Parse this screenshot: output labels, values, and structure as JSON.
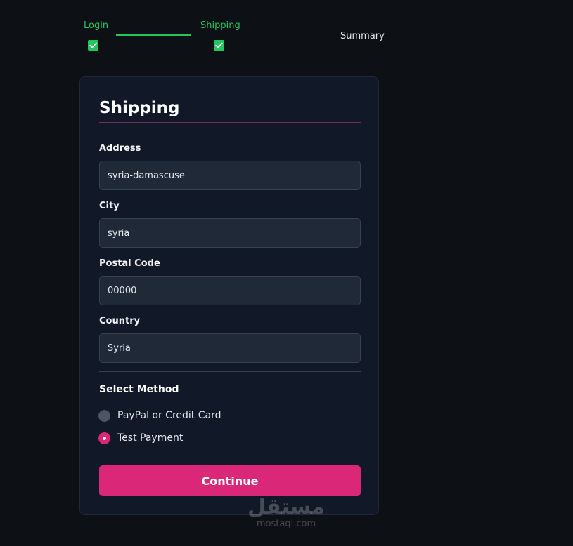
{
  "stepper": {
    "steps": [
      {
        "label": "Login",
        "completed": true
      },
      {
        "label": "Shipping",
        "completed": true
      },
      {
        "label": "Summary",
        "completed": false
      }
    ]
  },
  "shipping": {
    "title": "Shipping",
    "fields": {
      "address": {
        "label": "Address",
        "value": "syria-damascuse"
      },
      "city": {
        "label": "City",
        "value": "syria"
      },
      "postal_code": {
        "label": "Postal Code",
        "value": "00000"
      },
      "country": {
        "label": "Country",
        "value": "Syria"
      }
    },
    "method": {
      "heading": "Select Method",
      "options": [
        {
          "label": "PayPal or Credit Card",
          "selected": false
        },
        {
          "label": "Test Payment",
          "selected": true
        }
      ]
    },
    "continue_label": "Continue"
  },
  "watermark": {
    "arabic": "مستقل",
    "latin": "mostaql.com"
  },
  "colors": {
    "background": "#0d1015",
    "card": "#111827",
    "input": "#1f2937",
    "accent": "#db2777",
    "success": "#22c55e"
  }
}
